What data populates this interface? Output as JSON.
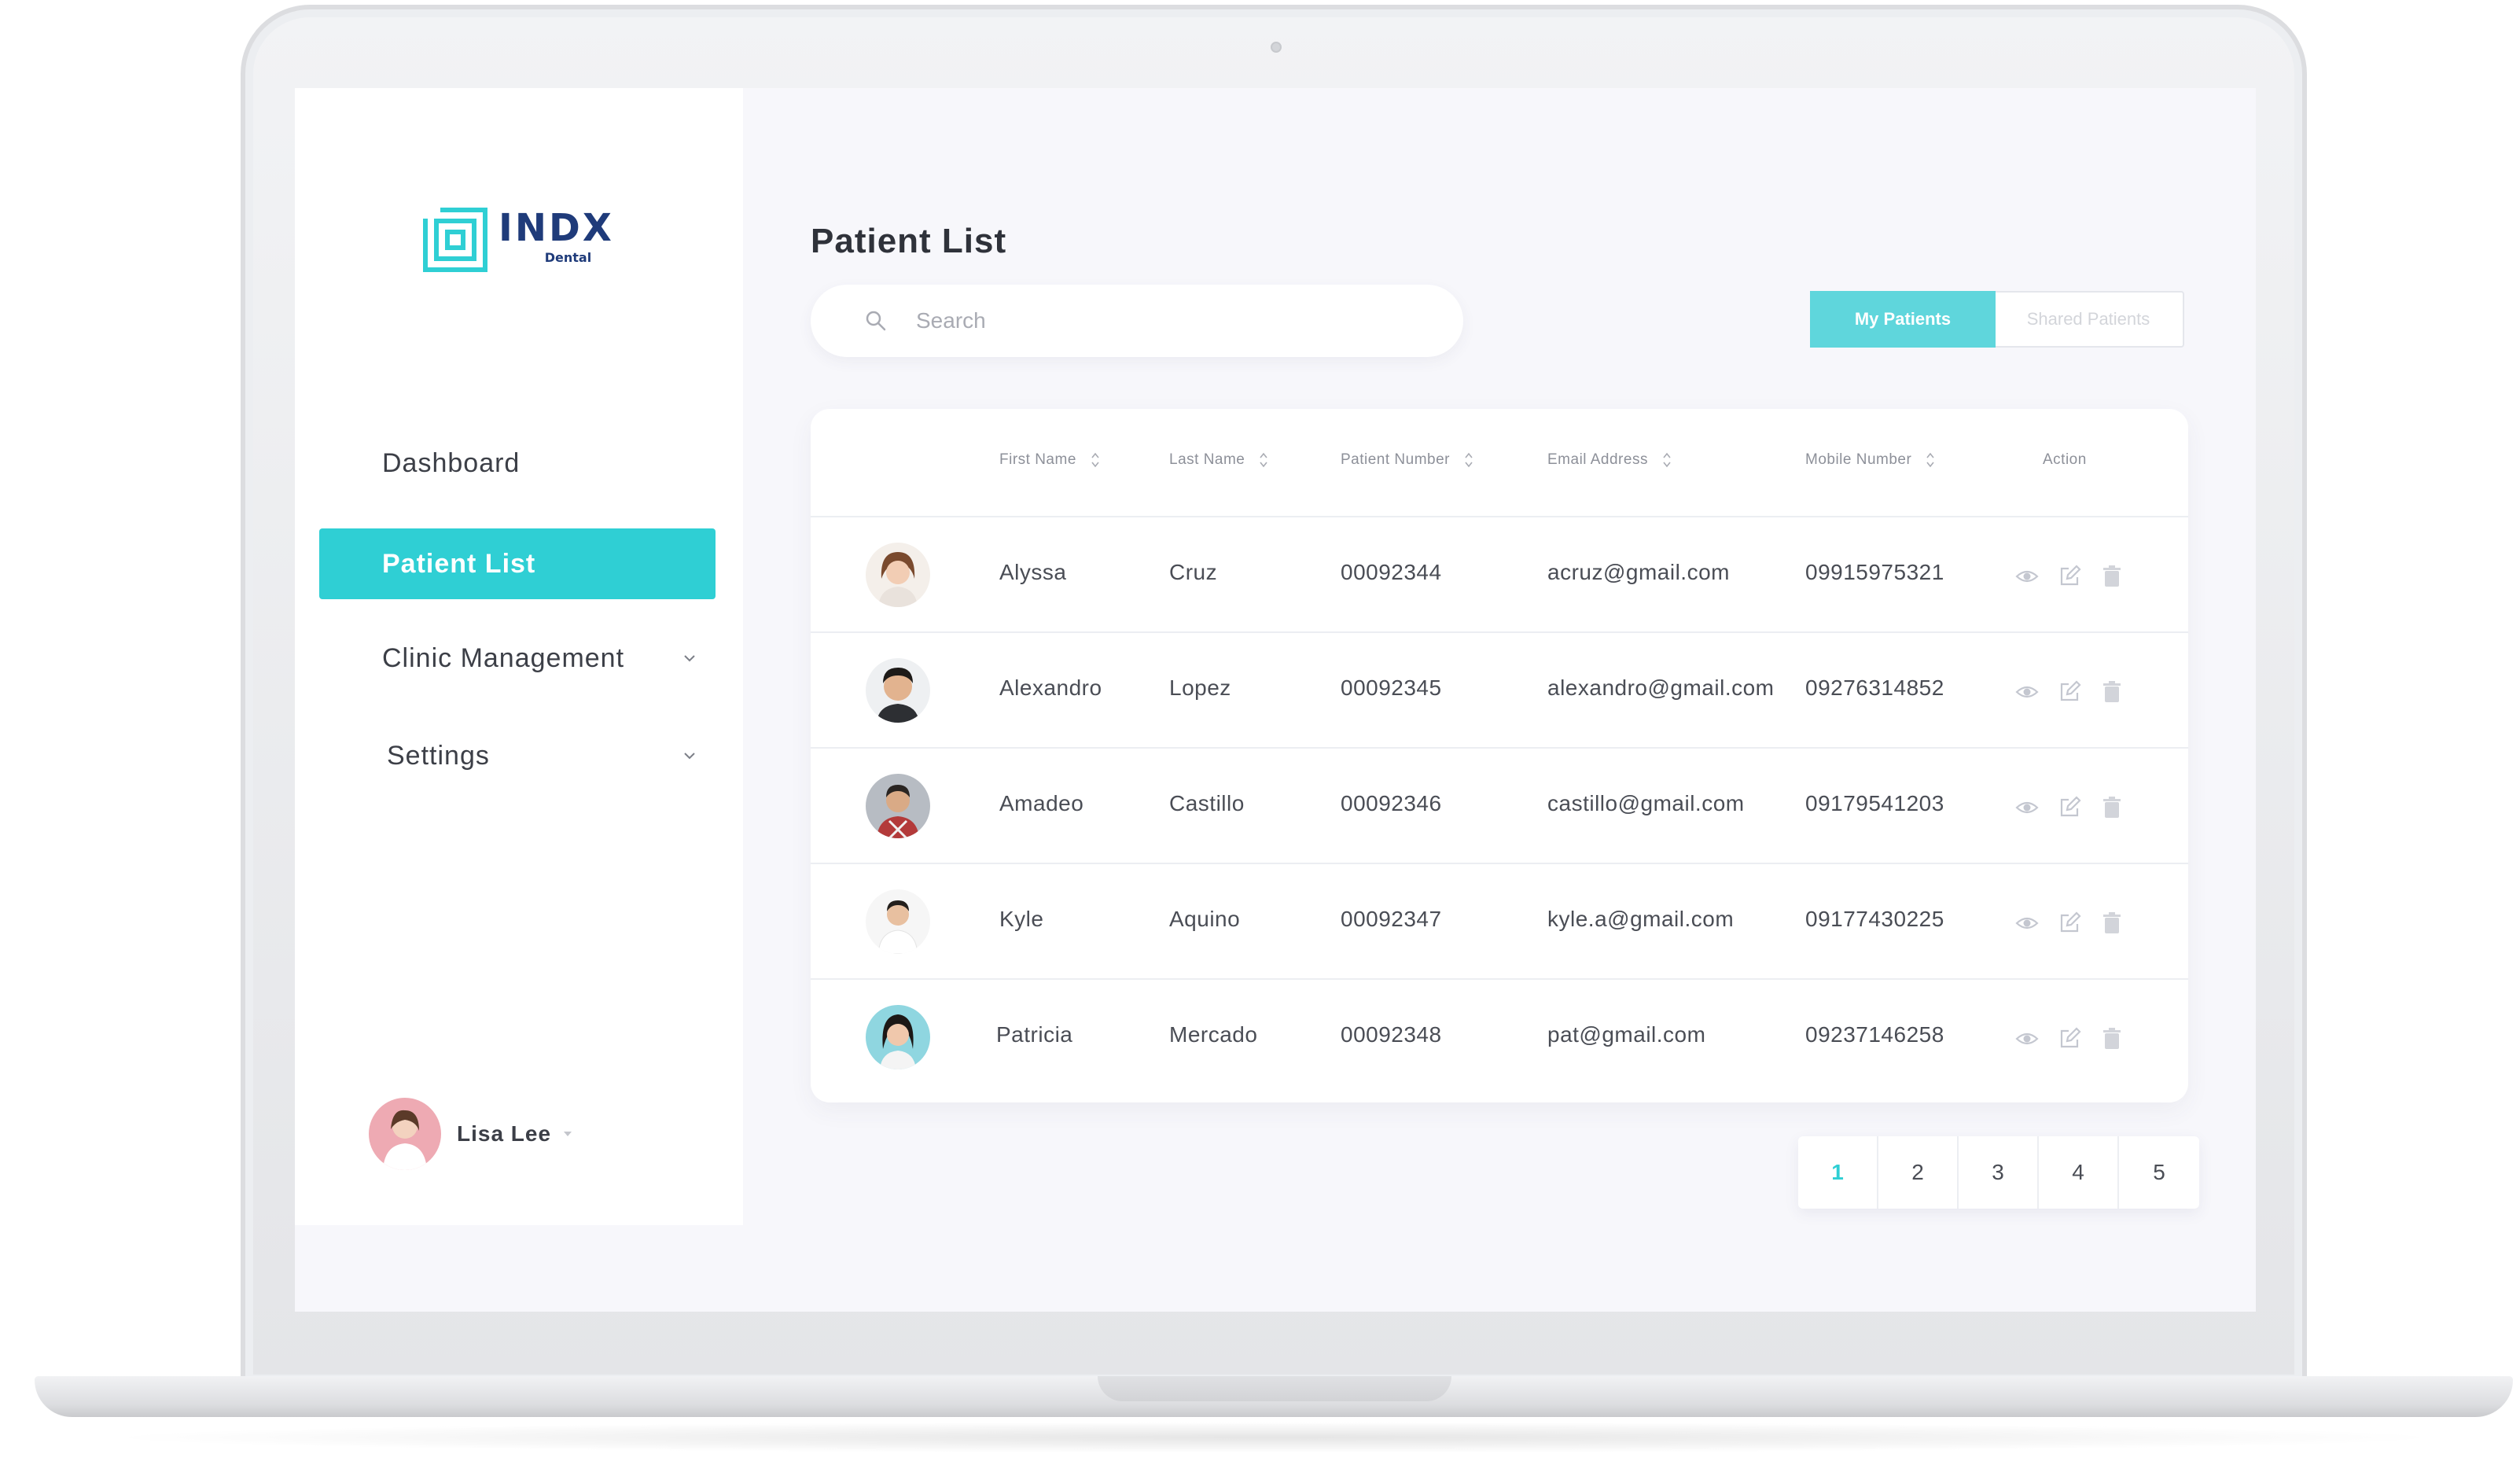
{
  "brand": {
    "name": "INDX",
    "sub": "Dental",
    "accent": "#2fcfd4",
    "navy": "#1f3b7a"
  },
  "sidebar": {
    "items": [
      {
        "label": "Dashboard",
        "active": false
      },
      {
        "label": "Patient List",
        "active": true
      },
      {
        "label": "Clinic Management",
        "active": false,
        "icon": "chevron-down-icon"
      },
      {
        "label": "Settings",
        "active": false,
        "icon": "chevron-down-icon"
      }
    ],
    "user": {
      "name": "Lisa Lee"
    }
  },
  "page": {
    "title": "Patient List"
  },
  "search": {
    "placeholder": "Search",
    "icon": "search-icon"
  },
  "toggle": {
    "my_patients": "My Patients",
    "shared_patients": "Shared Patients",
    "selected": "My Patients"
  },
  "table": {
    "headers": [
      "First Name",
      "Last Name",
      "Patient Number",
      "Email Address",
      "Mobile Number",
      "Action"
    ],
    "rows": [
      {
        "first": "Alyssa",
        "last": "Cruz",
        "number": "00092344",
        "email": "acruz@gmail.com",
        "mobile": "09915975321"
      },
      {
        "first": "Alexandro",
        "last": "Lopez",
        "number": "00092345",
        "email": "alexandro@gmail.com",
        "mobile": "09276314852"
      },
      {
        "first": "Amadeo",
        "last": "Castillo",
        "number": "00092346",
        "email": "castillo@gmail.com",
        "mobile": "09179541203"
      },
      {
        "first": "Kyle",
        "last": "Aquino",
        "number": "00092347",
        "email": "kyle.a@gmail.com",
        "mobile": "09177430225"
      },
      {
        "first": "Patricia",
        "last": "Mercado",
        "number": "00092348",
        "email": "pat@gmail.com",
        "mobile": "09237146258"
      }
    ],
    "action_icons": [
      "eye-icon",
      "edit-icon",
      "trash-icon"
    ]
  },
  "pagination": {
    "pages": [
      "1",
      "2",
      "3",
      "4",
      "5"
    ],
    "current": "1"
  }
}
